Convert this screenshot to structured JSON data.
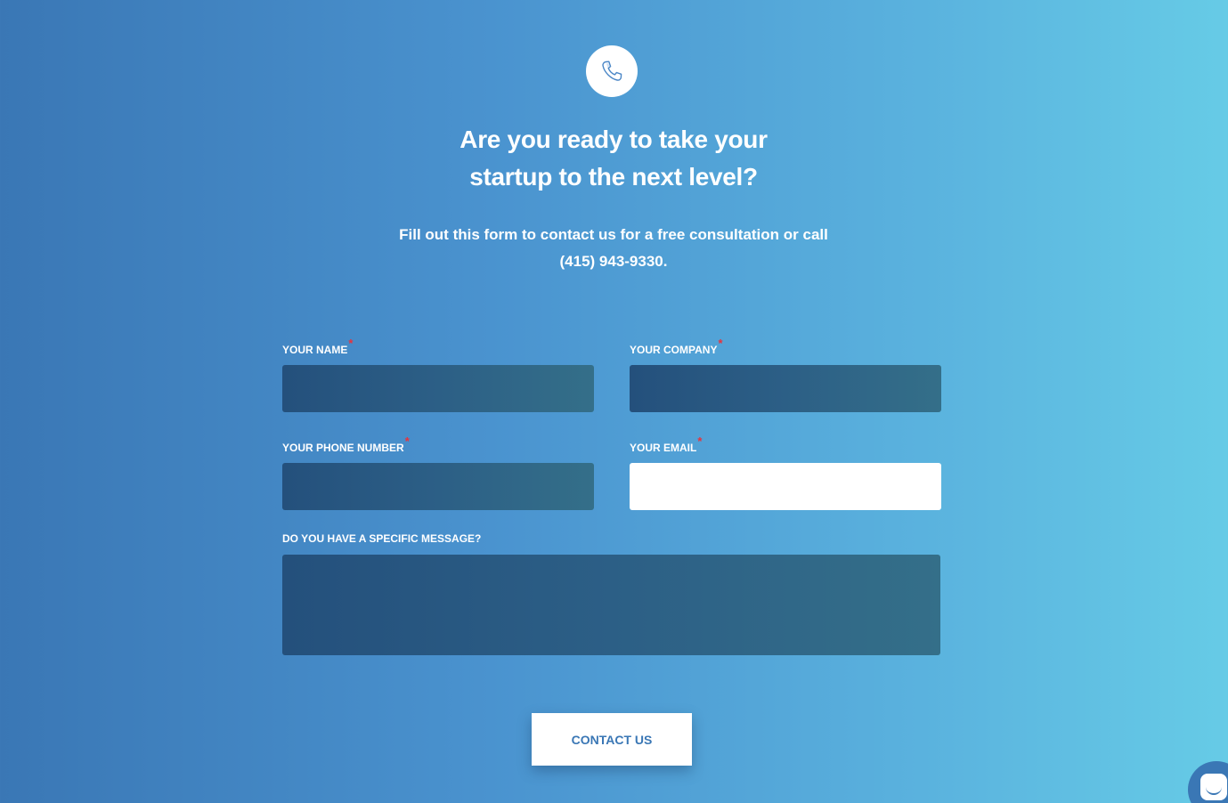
{
  "hero": {
    "icon": "phone-icon",
    "headline_line1": "Are you ready to take your",
    "headline_line2": "startup to the next level?",
    "subline_line1": "Fill out this form to contact us for a free consultation or call",
    "subline_line2": "(415) 943-9330."
  },
  "form": {
    "required_marker": "*",
    "fields": {
      "name": {
        "label": "YOUR NAME",
        "value": "",
        "required": true
      },
      "company": {
        "label": "YOUR COMPANY",
        "value": "",
        "required": true
      },
      "phone": {
        "label": "YOUR PHONE NUMBER",
        "value": "",
        "required": true
      },
      "email": {
        "label": "YOUR EMAIL",
        "value": "",
        "required": true
      },
      "message": {
        "label": "DO YOU HAVE A SPECIFIC MESSAGE?",
        "value": "",
        "required": false
      }
    },
    "submit_label": "CONTACT US"
  },
  "chat_widget": {
    "icon": "chat-icon"
  },
  "colors": {
    "gradient_start": "#3a77b5",
    "gradient_end": "#66cbe6",
    "field_dark": "#24507c",
    "accent": "#3a77b5",
    "required": "#e8323c"
  }
}
